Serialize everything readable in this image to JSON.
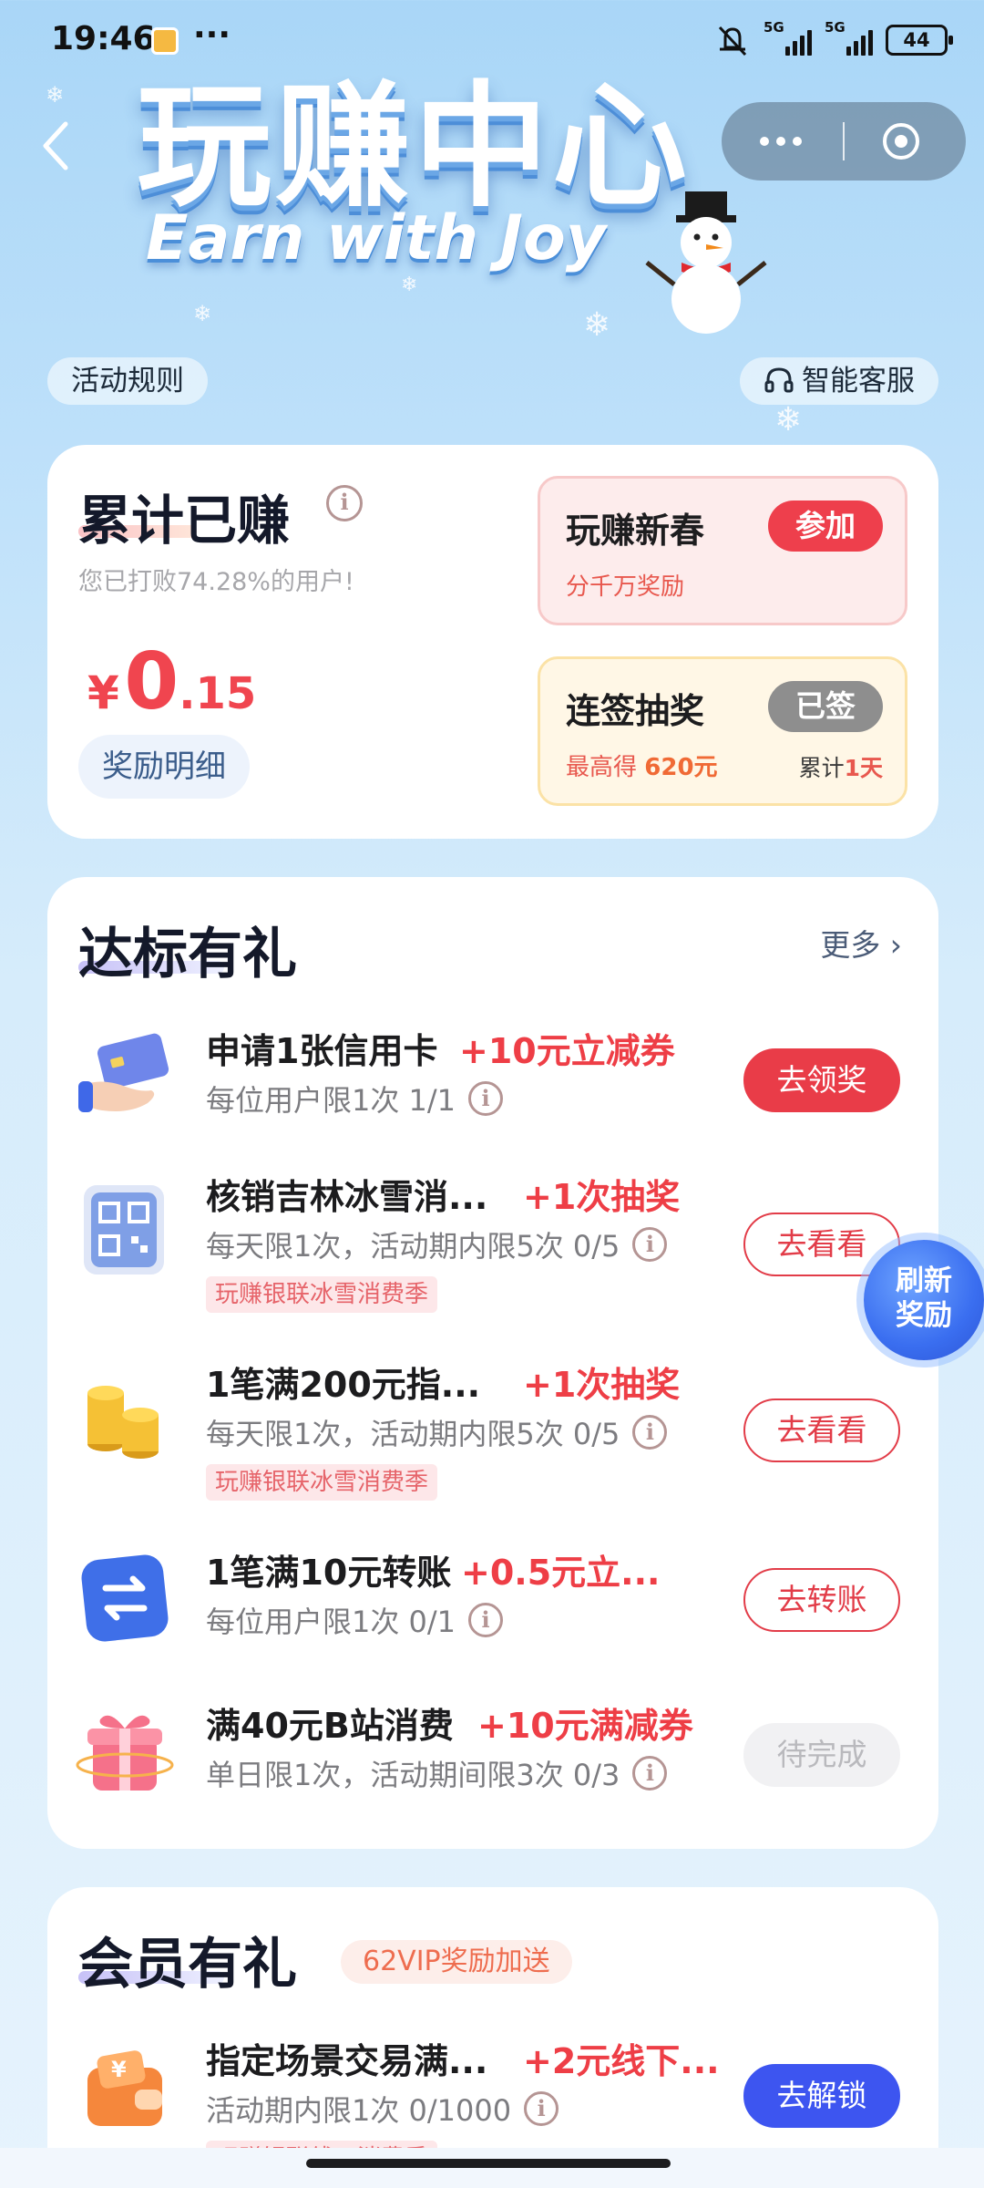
{
  "status_bar": {
    "time": "19:46",
    "dots": "···",
    "network_1": "5G",
    "network_2": "5G",
    "battery": "44"
  },
  "hero": {
    "title": "玩赚中心",
    "subtitle": "Earn with Joy"
  },
  "header": {
    "rules_label": "活动规则",
    "service_label": "智能客服"
  },
  "earnings": {
    "title": "累计已赚",
    "subtitle": "您已打败74.28%的用户!",
    "currency": "¥",
    "amount_int": "0",
    "amount_dec": ".15",
    "detail_label": "奖励明细",
    "newyear": {
      "title": "玩赚新春",
      "subtitle": "分千万奖励",
      "button": "参加"
    },
    "checkin": {
      "title": "连签抽奖",
      "subtitle_prefix": "最高得",
      "subtitle_amount": "620元",
      "button": "已签",
      "days_prefix": "累计",
      "days_value": "1天"
    }
  },
  "tasks": {
    "title": "达标有礼",
    "more": "更多 ›",
    "items": [
      {
        "name": "申请1张信用卡",
        "reward": "+10元立减券",
        "desc": "每位用户限1次 1/1",
        "tag": "",
        "button": "去领奖"
      },
      {
        "name": "核销吉林冰雪消...",
        "reward": "+1次抽奖",
        "desc": "每天限1次，活动期内限5次 0/5",
        "tag": "玩赚银联冰雪消费季",
        "button": "去看看"
      },
      {
        "name": "1笔满200元指...",
        "reward": "+1次抽奖",
        "desc": "每天限1次，活动期内限5次 0/5",
        "tag": "玩赚银联冰雪消费季",
        "button": "去看看"
      },
      {
        "name": "1笔满10元转账",
        "reward": "+0.5元立...",
        "desc": "每位用户限1次 0/1",
        "tag": "",
        "button": "去转账"
      },
      {
        "name": "满40元B站消费",
        "reward": "+10元满减券",
        "desc": "单日限1次，活动期间限3次 0/3",
        "tag": "",
        "button": "待完成"
      }
    ]
  },
  "refresh": {
    "line1": "刷新",
    "line2": "奖励"
  },
  "vip": {
    "title": "会员有礼",
    "badge": "62VIP奖励加送",
    "item": {
      "name": "指定场景交易满...",
      "reward": "+2元线下...",
      "desc": "活动期内限1次 0/1000",
      "tag": "玩赚银联线下消费季",
      "button": "去解锁"
    }
  },
  "colors": {
    "accent_red": "#e93c48",
    "accent_blue": "#3d55f0",
    "background": "#bfe1fa"
  }
}
